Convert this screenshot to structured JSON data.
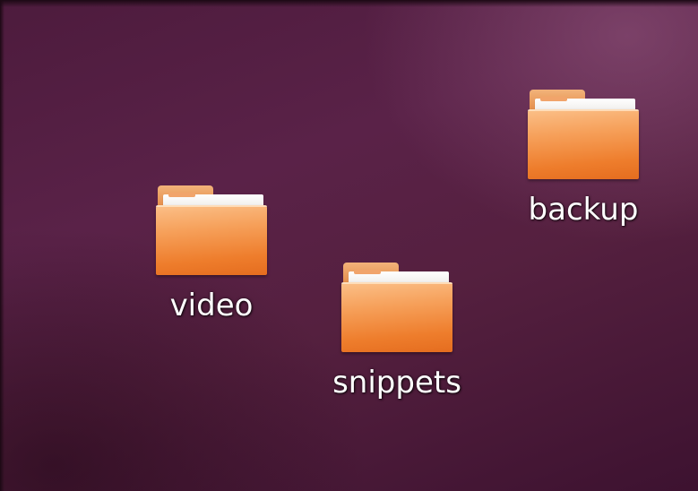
{
  "desktop": {
    "icons": [
      {
        "label": "video",
        "icon": "folder-icon"
      },
      {
        "label": "snippets",
        "icon": "folder-icon"
      },
      {
        "label": "backup",
        "icon": "folder-icon"
      }
    ]
  },
  "colors": {
    "background": "#55203f",
    "folder_orange": "#ee7d2c",
    "label_text": "#ffffff"
  }
}
